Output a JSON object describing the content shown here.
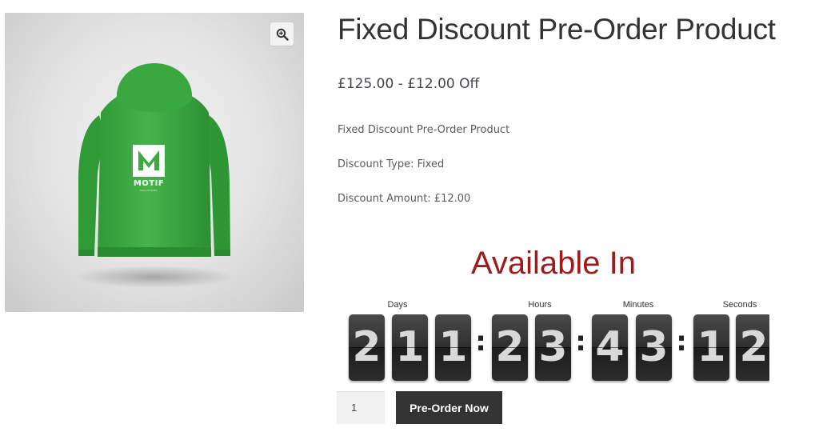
{
  "product": {
    "title": "Fixed Discount Pre-Order Product",
    "price": "£125.00 - £12.00 Off",
    "short_description": [
      "Fixed Discount Pre-Order Product",
      "Discount Type: Fixed",
      "Discount Amount: £12.00"
    ],
    "image": {
      "subject": "green hoodie back view",
      "logo_text": "MOTIF",
      "logo_subtext": "SOLUTIONS",
      "logo_letter": "M",
      "color": "#3ea943"
    },
    "zoom_icon": "magnifier-plus-icon"
  },
  "countdown": {
    "heading": "Available In",
    "heading_color": "#a11a1a",
    "labels": {
      "days": "Days",
      "hours": "Hours",
      "minutes": "Minutes",
      "seconds": "Seconds"
    },
    "days": [
      "2",
      "1",
      "1"
    ],
    "hours": [
      "2",
      "3"
    ],
    "minutes": [
      "4",
      "3"
    ],
    "seconds": [
      "1",
      "2"
    ],
    "separator": ":"
  },
  "cart": {
    "quantity": "1",
    "button_label": "Pre-Order Now"
  }
}
